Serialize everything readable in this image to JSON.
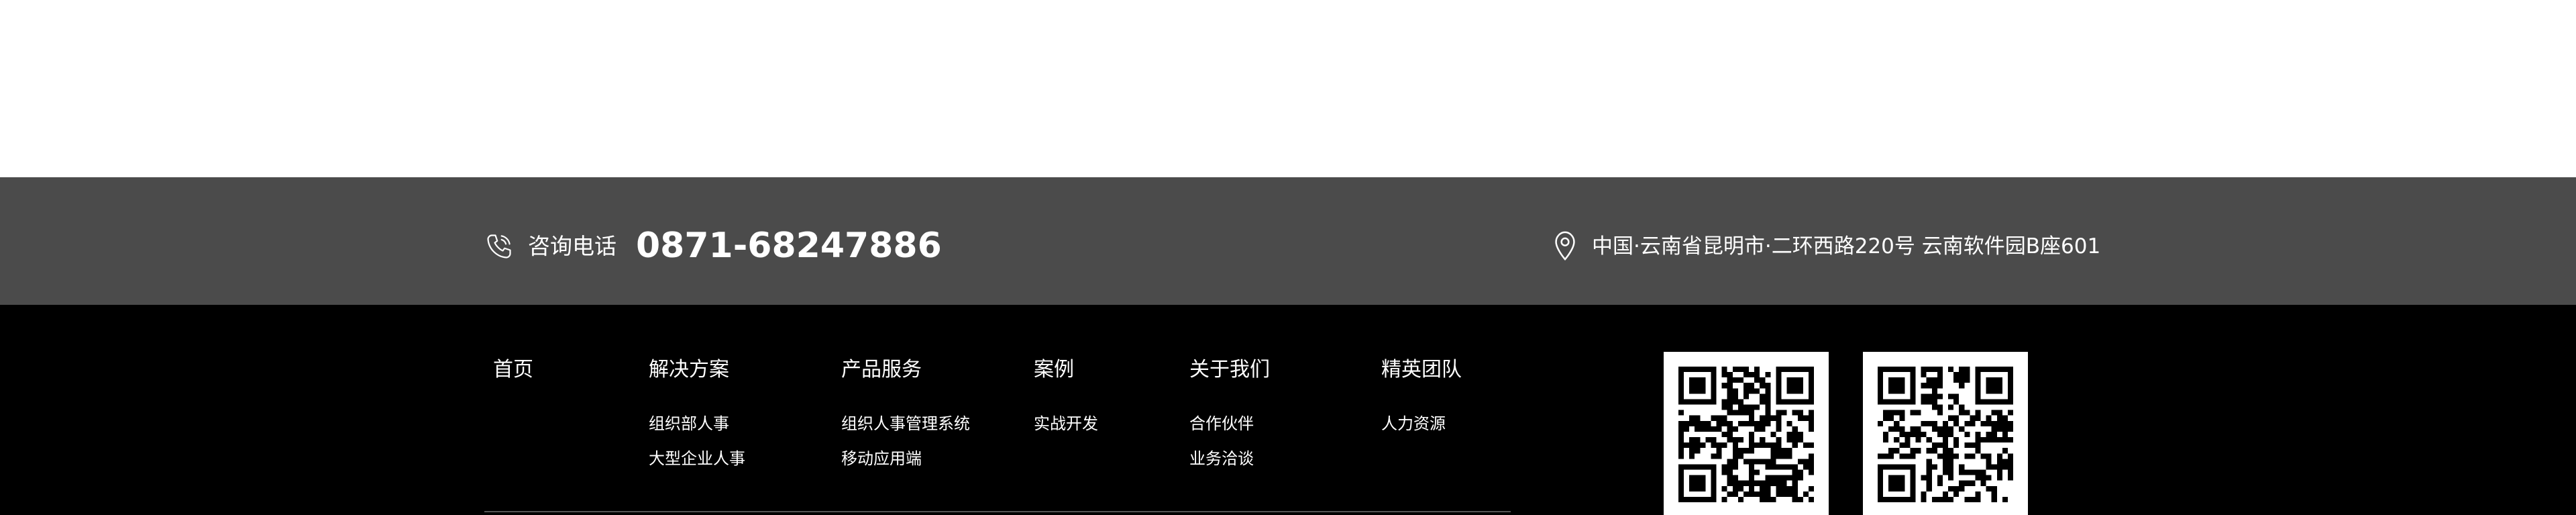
{
  "contact": {
    "phone_label": "咨询电话",
    "phone_number": "0871-68247886",
    "address": "中国·云南省昆明市·二环西路220号 云南软件园B座601"
  },
  "nav": [
    {
      "label": "首页",
      "items": []
    },
    {
      "label": "解决方案",
      "items": [
        "组织部人事",
        "大型企业人事"
      ]
    },
    {
      "label": "产品服务",
      "items": [
        "组织人事管理系统",
        "移动应用端"
      ]
    },
    {
      "label": "案例",
      "items": [
        "实战开发"
      ]
    },
    {
      "label": "关于我们",
      "items": [
        "合作伙伴",
        "业务洽谈"
      ]
    },
    {
      "label": "精英团队",
      "items": [
        "人力资源"
      ]
    }
  ],
  "icons": {
    "phone": "phone-icon",
    "location": "location-pin-icon",
    "qr": "qr-code-icon"
  },
  "colors": {
    "contact_bar": "#4b4b4b",
    "footer": "#000000",
    "text": "#ffffff"
  }
}
